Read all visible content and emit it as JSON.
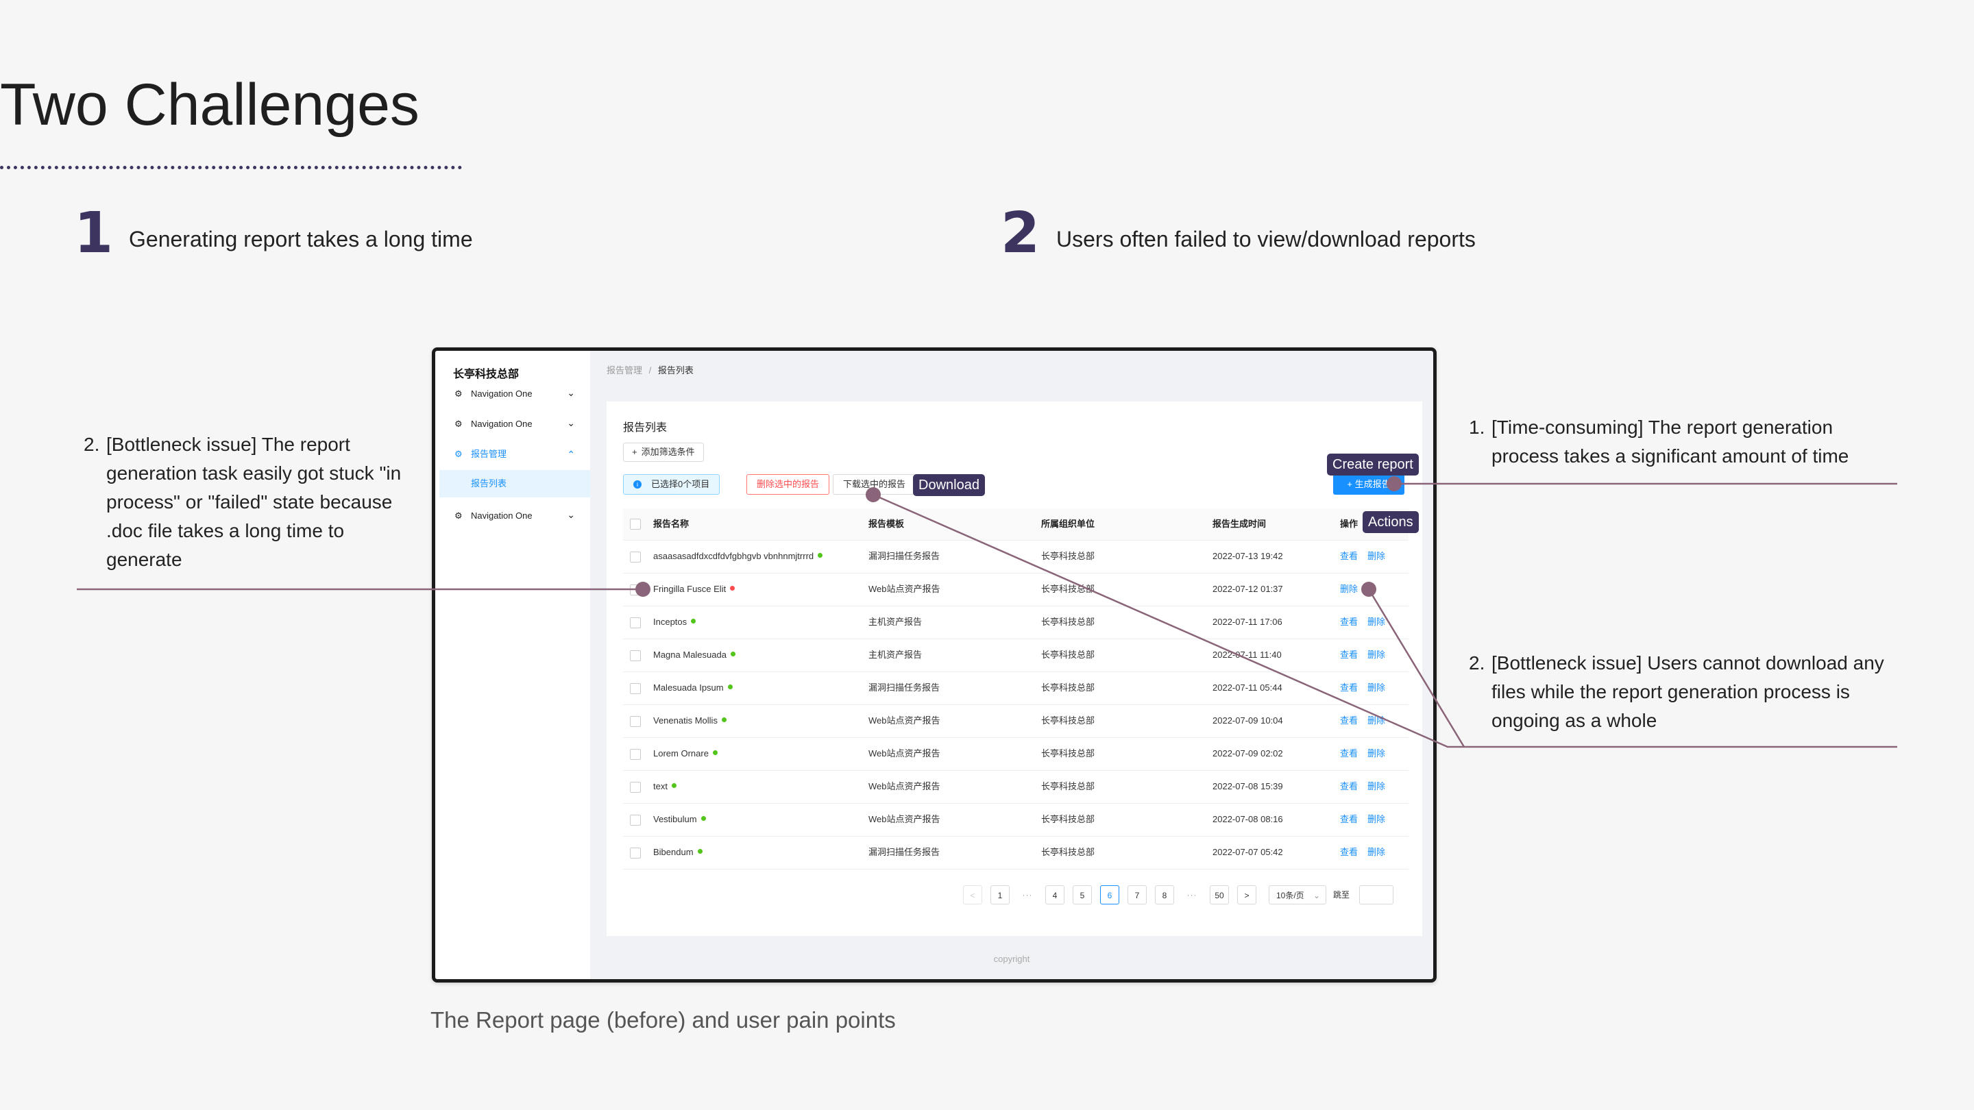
{
  "slide": {
    "title": "Two Challenges",
    "challenges": [
      {
        "number": "1",
        "text": "Generating report takes a long time"
      },
      {
        "number": "2",
        "text": "Users often failed to view/download reports"
      }
    ],
    "annotations": {
      "left": {
        "number": "2.",
        "text": "[Bottleneck issue] The report generation task easily got stuck \"in process\" or \"failed\" state because .doc file takes a long time to generate"
      },
      "right_top": {
        "number": "1.",
        "text": "[Time-consuming] The report generation process takes a significant amount of time"
      },
      "right_bottom": {
        "number": "2.",
        "text": "[Bottleneck issue] Users cannot download any files while the report generation process is ongoing as a whole"
      }
    },
    "tags": {
      "create": "Create report",
      "download": "Download",
      "actions": "Actions"
    },
    "caption": "The Report page (before) and user pain points",
    "accent_color": "#3d3560",
    "line_color": "#8a6478"
  },
  "app": {
    "brand": "长亭科技总部",
    "nav": [
      {
        "label": "Navigation One",
        "icon": "gear-icon"
      },
      {
        "label": "Navigation One",
        "icon": "gear-icon"
      },
      {
        "label": "报告管理",
        "icon": "gear-icon",
        "open": true,
        "sub": "报告列表"
      },
      {
        "label": "Navigation One",
        "icon": "gear-icon"
      }
    ],
    "breadcrumb": {
      "parent": "报告管理",
      "sep": "/",
      "current": "报告列表"
    },
    "card_title": "报告列表",
    "filter_label": "添加筛选条件",
    "selected_label": "已选择0个项目",
    "delete_label": "删除选中的报告",
    "download_label": "下载选中的报告",
    "create_label": "+ 生成报告",
    "columns": [
      "报告名称",
      "报告模板",
      "所属组织单位",
      "报告生成时间",
      "操作"
    ],
    "rows": [
      {
        "name": "asaasasadfdxcdfdvfgbhgvb vbnhnmjtrrrd",
        "status": "green",
        "template": "漏洞扫描任务报告",
        "org": "长亭科技总部",
        "time": "2022-07-13 19:42",
        "actions": [
          "查看",
          "删除"
        ]
      },
      {
        "name": "Fringilla Fusce Elit",
        "status": "red",
        "template": "Web站点资产报告",
        "org": "长亭科技总部",
        "time": "2022-07-12 01:37",
        "actions": [
          "删除"
        ]
      },
      {
        "name": "Inceptos",
        "status": "green",
        "template": "主机资产报告",
        "org": "长亭科技总部",
        "time": "2022-07-11 17:06",
        "actions": [
          "查看",
          "删除"
        ]
      },
      {
        "name": "Magna Malesuada",
        "status": "green",
        "template": "主机资产报告",
        "org": "长亭科技总部",
        "time": "2022-07-11 11:40",
        "actions": [
          "查看",
          "删除"
        ]
      },
      {
        "name": "Malesuada Ipsum",
        "status": "green",
        "template": "漏洞扫描任务报告",
        "org": "长亭科技总部",
        "time": "2022-07-11 05:44",
        "actions": [
          "查看",
          "删除"
        ]
      },
      {
        "name": "Venenatis Mollis",
        "status": "green",
        "template": "Web站点资产报告",
        "org": "长亭科技总部",
        "time": "2022-07-09 10:04",
        "actions": [
          "查看",
          "删除"
        ]
      },
      {
        "name": "Lorem Ornare",
        "status": "green",
        "template": "Web站点资产报告",
        "org": "长亭科技总部",
        "time": "2022-07-09 02:02",
        "actions": [
          "查看",
          "删除"
        ]
      },
      {
        "name": "text",
        "status": "green",
        "template": "Web站点资产报告",
        "org": "长亭科技总部",
        "time": "2022-07-08 15:39",
        "actions": [
          "查看",
          "删除"
        ]
      },
      {
        "name": "Vestibulum",
        "status": "green",
        "template": "Web站点资产报告",
        "org": "长亭科技总部",
        "time": "2022-07-08 08:16",
        "actions": [
          "查看",
          "删除"
        ]
      },
      {
        "name": "Bibendum",
        "status": "green",
        "template": "漏洞扫描任务报告",
        "org": "长亭科技总部",
        "time": "2022-07-07 05:42",
        "actions": [
          "查看",
          "删除"
        ]
      }
    ],
    "status_colors": {
      "green": "#52c41a",
      "red": "#ff4d4f"
    },
    "pagination": {
      "prev": "<",
      "next": ">",
      "ellipsis": "···",
      "pages": [
        "1",
        "4",
        "5",
        "6",
        "7",
        "8",
        "50"
      ],
      "current": "6",
      "page_size": "10条/页",
      "jump_label": "跳至"
    },
    "footer": "copyright"
  }
}
